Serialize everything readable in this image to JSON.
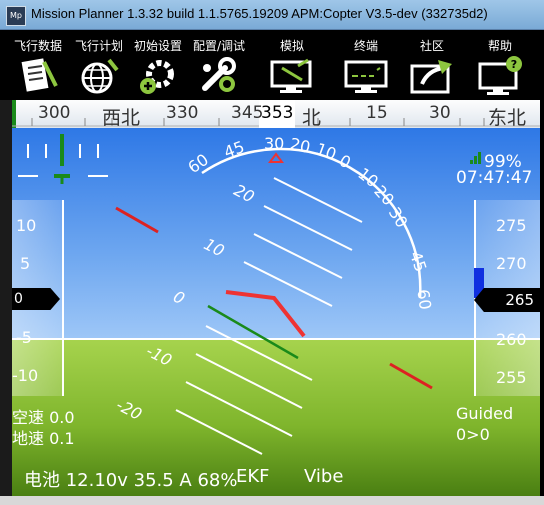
{
  "window": {
    "icon_text": "Mp",
    "title": "Mission Planner 1.3.32 build 1.1.5765.19209 APM:Copter V3.5-dev (332735d2)"
  },
  "toolbar": {
    "items": [
      {
        "label": "飞行数据",
        "icon": "flight-data-icon"
      },
      {
        "label": "飞行计划",
        "icon": "flight-plan-icon"
      },
      {
        "label": "初始设置",
        "icon": "initial-setup-icon"
      },
      {
        "label": "配置/调试",
        "icon": "config-tuning-icon"
      },
      {
        "label": "模拟",
        "icon": "simulation-icon"
      },
      {
        "label": "终端",
        "icon": "terminal-icon"
      },
      {
        "label": "社区",
        "icon": "community-icon"
      },
      {
        "label": "帮助",
        "icon": "help-icon"
      }
    ]
  },
  "compass": {
    "labels": [
      "300",
      "西北",
      "330",
      "345",
      "353",
      "北",
      "15",
      "30",
      "东北"
    ],
    "heading": "353"
  },
  "hud": {
    "pitch_labels": [
      "20",
      "10",
      "0",
      "-10",
      "-20"
    ],
    "roll_labels": [
      "60",
      "45",
      "30",
      "20",
      "10",
      "0",
      "10",
      "20",
      "30",
      "45",
      "60"
    ],
    "speed_tape": [
      "10",
      "5",
      "0",
      "-5",
      "-10"
    ],
    "speed_value": "0",
    "alt_tape": [
      "275",
      "270",
      "265",
      "260",
      "255"
    ],
    "alt_value": "265",
    "signal_percent": "99%",
    "time": "07:47:47",
    "airspeed": "空速 0.0",
    "groundspeed": "地速 0.1",
    "mode": "Guided",
    "wp_info": "0>0",
    "battery": "电池 12.10v 35.5 A 68%",
    "ekf": "EKF",
    "vibe": "Vibe"
  }
}
